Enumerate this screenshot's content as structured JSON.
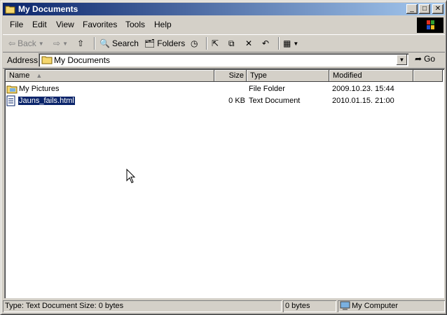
{
  "window": {
    "title": "My Documents",
    "caption_buttons": {
      "minimize": "_",
      "maximize": "□",
      "close": "✕"
    }
  },
  "menu": [
    "File",
    "Edit",
    "View",
    "Favorites",
    "Tools",
    "Help"
  ],
  "toolbar": {
    "back_label": "Back",
    "search_label": "Search",
    "folders_label": "Folders"
  },
  "address": {
    "label": "Address",
    "value": "My Documents",
    "go_label": "Go"
  },
  "columns": [
    "Name",
    "Size",
    "Type",
    "Modified"
  ],
  "files": [
    {
      "name": "My Pictures",
      "size": "",
      "type": "File Folder",
      "modified": "2009.10.23. 15:44",
      "icon": "folder-pictures-icon"
    },
    {
      "name": "Jauns_fails.html",
      "size": "0 KB",
      "type": "Text Document",
      "modified": "2010.01.15. 21:00",
      "icon": "html-document-icon",
      "selected": true
    }
  ],
  "status": {
    "info": "Type: Text Document Size: 0 bytes",
    "size": "0 bytes",
    "zone": "My Computer"
  },
  "colors": {
    "title_active": "#0a246a",
    "selection": "#0a246a",
    "face": "#d4d0c8"
  }
}
